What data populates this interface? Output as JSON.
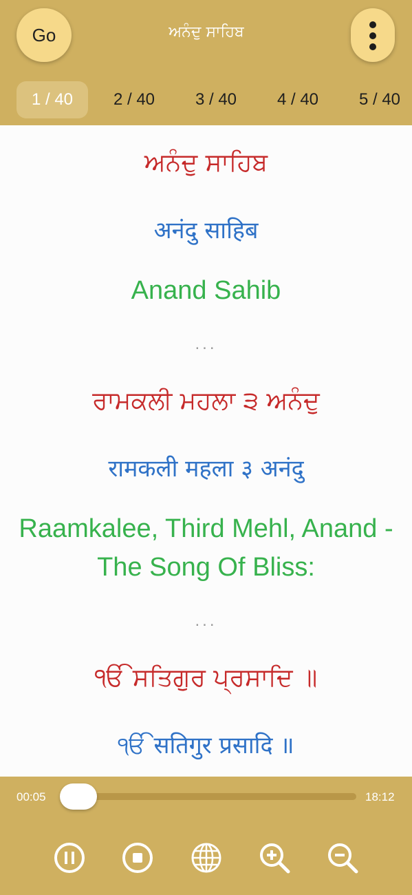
{
  "header": {
    "go_label": "Go",
    "title": "ਅਨੰਦੁ ਸਾਹਿਬ",
    "more_icon": "vertical-ellipsis-icon"
  },
  "pages": [
    {
      "label": "1 / 40",
      "active": true
    },
    {
      "label": "2 / 40",
      "active": false
    },
    {
      "label": "3 / 40",
      "active": false
    },
    {
      "label": "4 / 40",
      "active": false
    },
    {
      "label": "5 / 40",
      "active": false
    }
  ],
  "verses": [
    {
      "gurmukhi": "ਅਨੰਦੁ ਸਾਹਿਬ",
      "devanagari": "अनंदु साहिब",
      "english": "Anand Sahib",
      "separator": "..."
    },
    {
      "gurmukhi": "ਰਾਮਕਲੀ ਮਹਲਾ ੩ ਅਨੰਦੁ",
      "devanagari": "रामकली महला ३ अनंदु",
      "english_line1": "Raamkalee, Third Mehl, Anand -",
      "english_line2": "The Song Of Bliss:",
      "separator": "..."
    },
    {
      "gurmukhi": "ੴ ਸਤਿਗੁਰ ਪ੍ਰਸਾਦਿ ॥",
      "devanagari": "ੴ सतिगुर प्रसादि ॥"
    }
  ],
  "player": {
    "elapsed": "00:05",
    "total": "18:12",
    "progress_fraction": 0.005,
    "controls": [
      "pause-icon",
      "stop-icon",
      "globe-icon",
      "zoom-in-icon",
      "zoom-out-icon"
    ]
  },
  "colors": {
    "header_bg": "#cfb060",
    "button_bg": "#f6d98a",
    "gurmukhi": "#c62a2a",
    "devanagari": "#2f72c7",
    "english": "#37b24d"
  }
}
